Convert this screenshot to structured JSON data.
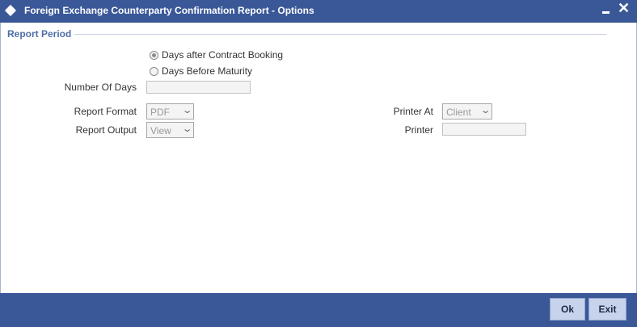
{
  "window": {
    "title": "Foreign Exchange Counterparty Confirmation Report - Options"
  },
  "report_period": {
    "section_title": "Report Period",
    "options": [
      {
        "label": "Days after Contract Booking",
        "selected": true
      },
      {
        "label": "Days Before Maturity",
        "selected": false
      }
    ],
    "number_of_days_label": "Number Of Days",
    "number_of_days_value": ""
  },
  "report": {
    "format_label": "Report Format",
    "format_value": "PDF",
    "output_label": "Report Output",
    "output_value": "View",
    "printer_at_label": "Printer At",
    "printer_at_value": "Client",
    "printer_label": "Printer",
    "printer_value": ""
  },
  "footer": {
    "ok_label": "Ok",
    "exit_label": "Exit"
  },
  "colors": {
    "titlebar": "#3a5898",
    "section_title": "#4f6ea8",
    "button_bg": "#c7d3ea"
  },
  "icons": {
    "title": "diamond-icon",
    "minimize": "minimize-icon",
    "close": "close-icon",
    "dropdown": "chevron-down-icon"
  }
}
